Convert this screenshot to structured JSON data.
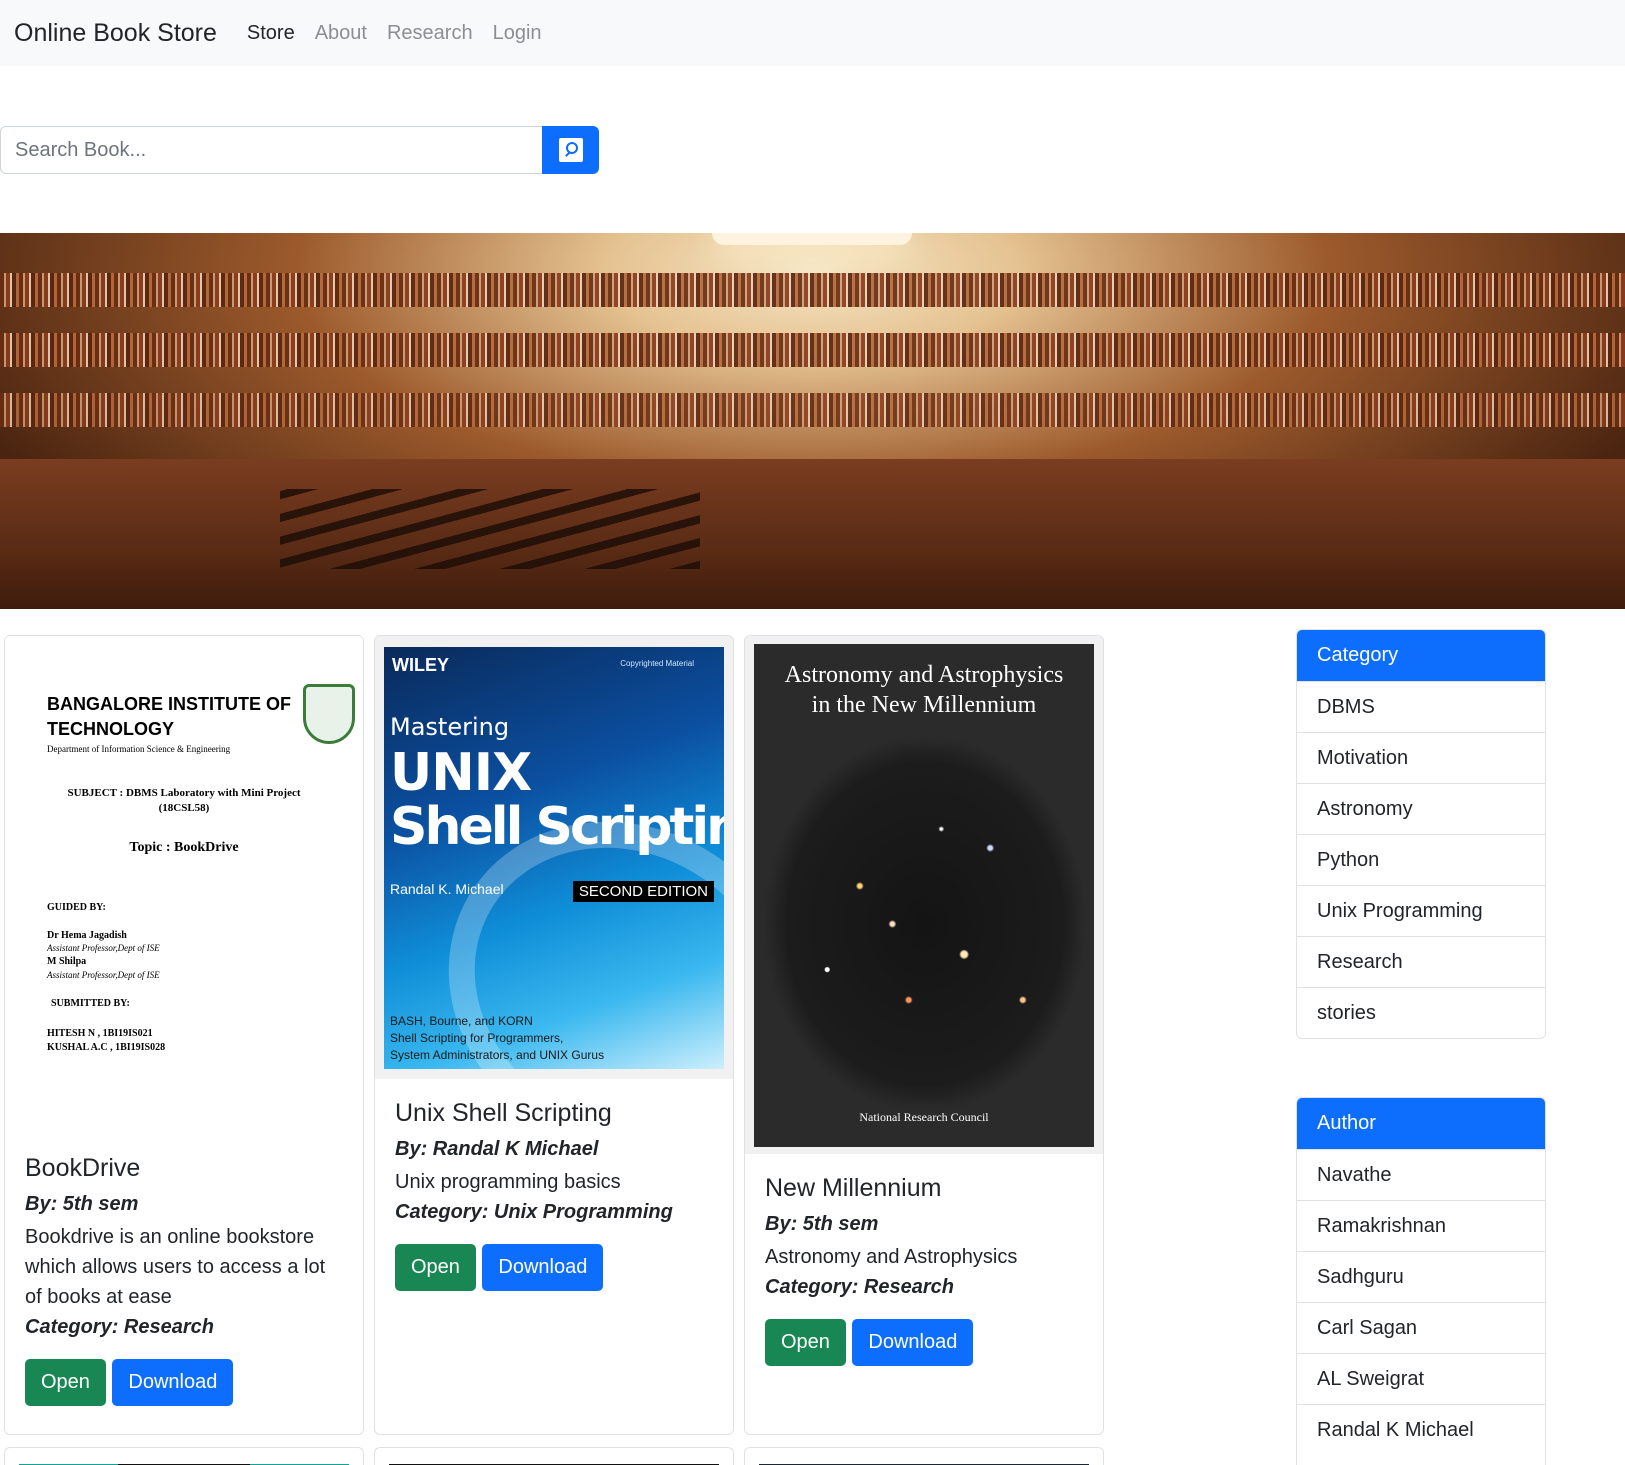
{
  "navbar": {
    "brand": "Online Book Store",
    "links": [
      "Store",
      "About",
      "Research",
      "Login"
    ]
  },
  "search": {
    "placeholder": "Search Book...",
    "icon": "search-icon"
  },
  "books": [
    {
      "title": "BookDrive",
      "by": "By: 5th sem",
      "desc": "Bookdrive is an online bookstore which allows users to access a lot of books at ease",
      "category": "Category: Research",
      "open": "Open",
      "download": "Download",
      "cover": {
        "institution_line1": "BANGALORE INSTITUTE OF",
        "institution_line2": "TECHNOLOGY",
        "dept": "Department of Information Science & Engineering",
        "subject_line1": "SUBJECT :   DBMS Laboratory with Mini Project",
        "subject_line2": "(18CSL58)",
        "topic": "Topic :  BookDrive",
        "guided_by": "GUIDED BY:",
        "guide1": "Dr Hema Jagadish",
        "guide1_role": "Assistant Professor,Dept of ISE",
        "guide2": "M  Shilpa",
        "guide2_role": "Assistant Professor,Dept of ISE",
        "submitted_by": "SUBMITTED BY:",
        "student1": "HITESH N  , 1BI19IS021",
        "student2": "KUSHAL A.C  ,  1BI19IS028"
      }
    },
    {
      "title": "Unix Shell Scripting",
      "by": "By: Randal K Michael",
      "desc": "Unix programming basics",
      "category": "Category: Unix Programming",
      "open": "Open",
      "download": "Download",
      "cover": {
        "publisher": "WILEY",
        "copyright": "Copyrighted Material",
        "mastering": "Mastering",
        "unix": "UNIX",
        "shell": "Shell Scripting",
        "author": "Randal K. Michael",
        "edition": "SECOND EDITION",
        "sub1": "BASH, Bourne, and KORN",
        "sub2": "Shell Scripting for Programmers,",
        "sub3": "System Administrators, and UNIX Gurus"
      }
    },
    {
      "title": "New Millennium",
      "by": "By: 5th sem",
      "desc": "Astronomy and Astrophysics",
      "category": "Category: Research",
      "open": "Open",
      "download": "Download",
      "cover": {
        "title_line1": "Astronomy and Astrophysics",
        "title_line2": "in the New Millennium",
        "publisher": "National Research Council"
      }
    }
  ],
  "sidebar": {
    "category_title": "Category",
    "categories": [
      "DBMS",
      "Motivation",
      "Astronomy",
      "Python",
      "Unix Programming",
      "Research",
      "stories"
    ],
    "author_title": "Author",
    "authors": [
      "Navathe",
      "Ramakrishnan",
      "Sadhguru",
      "Carl Sagan",
      "AL Sweigrat",
      "Randal K Michael"
    ]
  },
  "colors": {
    "primary": "#0d6efd",
    "success": "#198754",
    "navbar_bg": "#f8f9fa"
  }
}
